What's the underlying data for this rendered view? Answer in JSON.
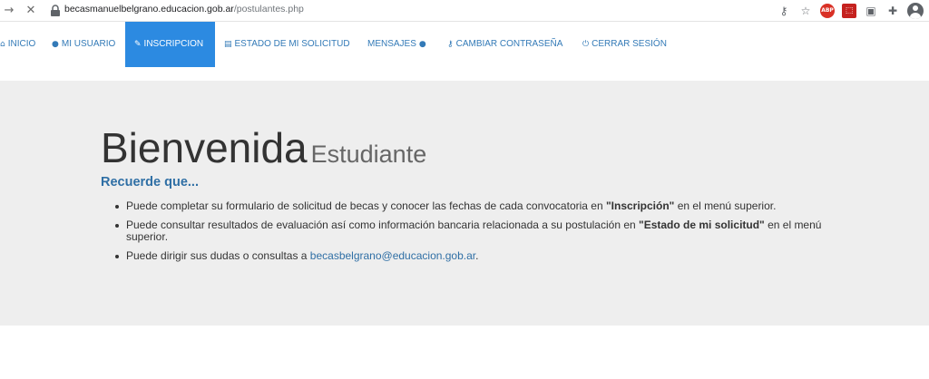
{
  "browser": {
    "url_host": "becasmanuelbelgrano.educacion.gob.ar",
    "url_path": "/postulantes.php",
    "icons": [
      "back-arrow-icon",
      "stop-icon",
      "lock-icon",
      "key-icon",
      "star-icon",
      "adblock-icon",
      "pdf-icon",
      "extension-icon",
      "puzzle-icon",
      "account-icon"
    ],
    "adblock_label": "ABP"
  },
  "nav": {
    "items": [
      {
        "label": "INICIO",
        "icon": "home-icon"
      },
      {
        "label": "MI USUARIO",
        "icon": "user-icon"
      },
      {
        "label": "INSCRIPCION",
        "icon": "edit-icon",
        "active": true
      },
      {
        "label": "ESTADO DE MI SOLICITUD",
        "icon": "list-icon"
      },
      {
        "label": "MENSAJES",
        "icon": "comments-icon"
      },
      {
        "label": "CAMBIAR CONTRASEÑA",
        "icon": "key-icon"
      },
      {
        "label": "CERRAR SESIÓN",
        "icon": "power-icon"
      }
    ],
    "active_color": "#2c8ae1",
    "link_color": "#337ab7"
  },
  "welcome": {
    "title": "Bienvenida",
    "subtitle": "Estudiante",
    "heading": "Recuerde que...",
    "bullet1_pre": "Puede completar su formulario de solicitud de becas y conocer las fechas de cada convocatoria en ",
    "bullet1_bold": "\"Inscripción\"",
    "bullet1_post": " en el menú superior.",
    "bullet2_pre": "Puede consultar resultados de evaluación así como información bancaria relacionada a su postulación en ",
    "bullet2_bold": "\"Estado de mi solicitud\"",
    "bullet2_post": " en el menú superior.",
    "bullet3_pre": "Puede dirigir sus dudas o consultas a ",
    "bullet3_link": "becasbelgrano@educacion.gob.ar",
    "bullet3_post": "."
  }
}
